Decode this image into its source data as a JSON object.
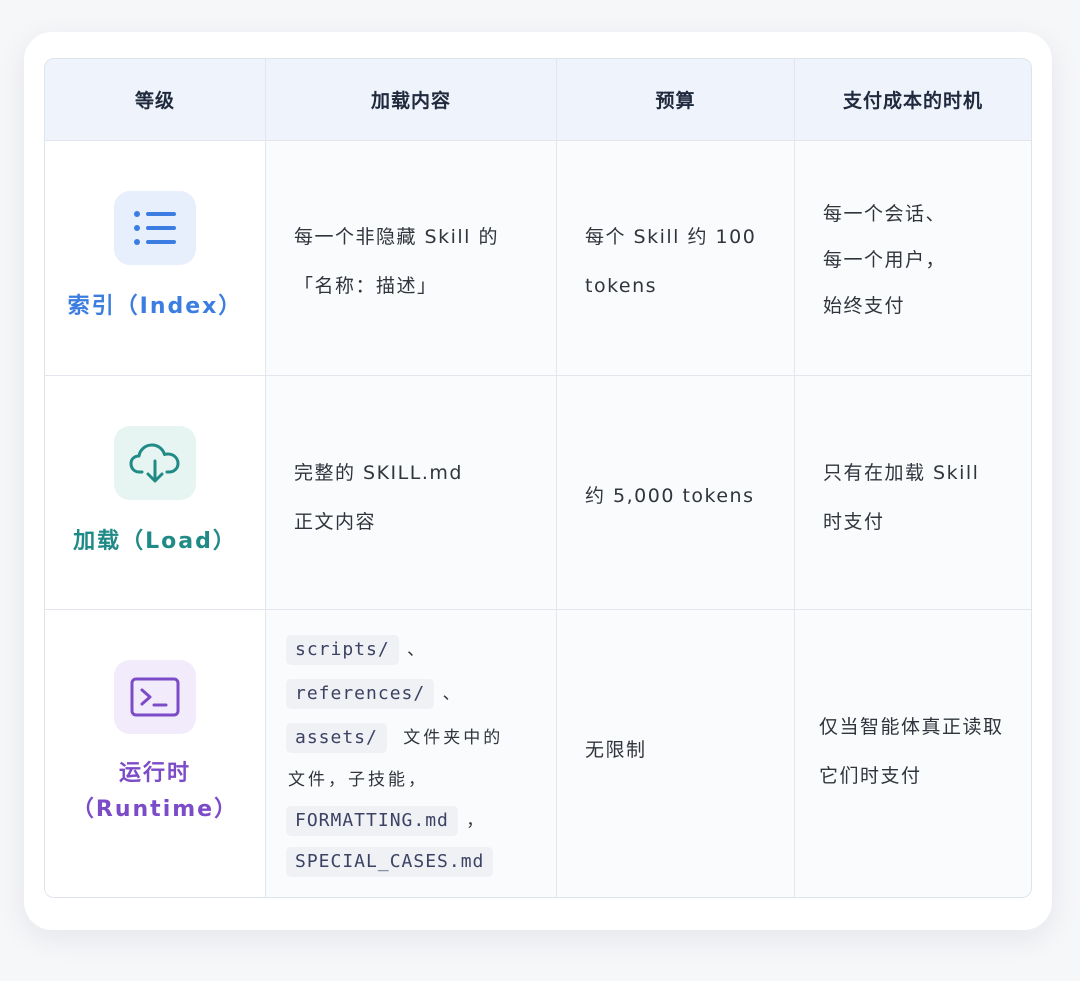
{
  "colors": {
    "header_bg": "#eef3fc",
    "index_accent": "#3b7de0",
    "load_accent": "#1f8a86",
    "runtime_accent": "#7c4cc8"
  },
  "headers": [
    "等级",
    "加载内容",
    "预算",
    "支付成本的时机"
  ],
  "rows": [
    {
      "icon": "list-icon",
      "level": "索引（Index）",
      "content_lines": [
        "每一个非隐藏 Skill 的",
        "「名称：描述」"
      ],
      "budget_lines": [
        "每个 Skill 约 100",
        "tokens"
      ],
      "timing_lines": [
        "每一个会话、",
        "每一个用户，",
        "始终支付"
      ]
    },
    {
      "icon": "cloud-download-icon",
      "level": "加载（Load）",
      "content_lines": [
        "完整的 SKILL.md",
        "正文内容"
      ],
      "budget_lines": [
        "约 5,000 tokens"
      ],
      "timing_lines": [
        "只有在加载 Skill",
        "时支付"
      ]
    },
    {
      "icon": "terminal-icon",
      "level_line1": "运行时",
      "level_line2": "（Runtime）",
      "content": {
        "code1": "scripts/",
        "sep1": "、",
        "code2": "references/",
        "sep2": "、",
        "code3": "assets/",
        "text3": "文件夹中的",
        "text4": "文件，子技能，",
        "code5": "FORMATTING.md",
        "sep5": "，",
        "code6": "SPECIAL_CASES.md"
      },
      "budget": "无限制",
      "timing_lines": [
        "仅当智能体真正读取",
        "它们时支付"
      ]
    }
  ]
}
